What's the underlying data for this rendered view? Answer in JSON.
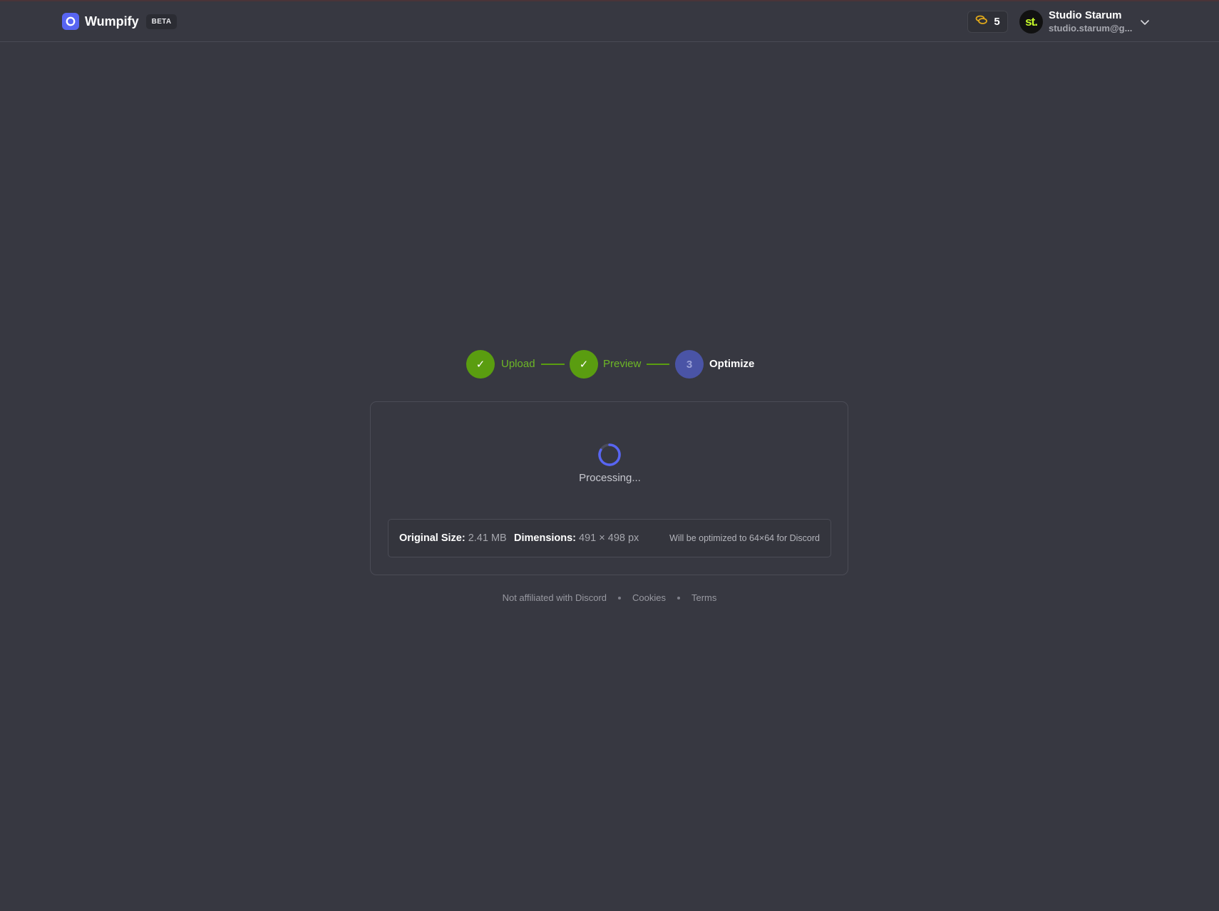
{
  "app": {
    "name": "Wumpify",
    "badge": "BETA"
  },
  "header": {
    "credits": "5",
    "user": {
      "avatar_text": "st.",
      "name": "Studio Starum",
      "email": "studio.starum@g..."
    }
  },
  "stepper": {
    "steps": [
      {
        "label": "Upload",
        "state": "done"
      },
      {
        "label": "Preview",
        "state": "done"
      },
      {
        "label": "Optimize",
        "state": "current",
        "number": "3"
      }
    ]
  },
  "card": {
    "status": "Processing...",
    "info": {
      "original_size_label": "Original Size:",
      "original_size_value": "2.41 MB",
      "dimensions_label": "Dimensions:",
      "dimensions_value": "491 × 498 px",
      "note": "Will be optimized to 64×64 for Discord"
    }
  },
  "footer": {
    "links": [
      "Not affiliated with Discord",
      "Cookies",
      "Terms"
    ]
  },
  "colors": {
    "background": "#373841",
    "accent": "#5865f2",
    "success": "#5a9d10"
  }
}
